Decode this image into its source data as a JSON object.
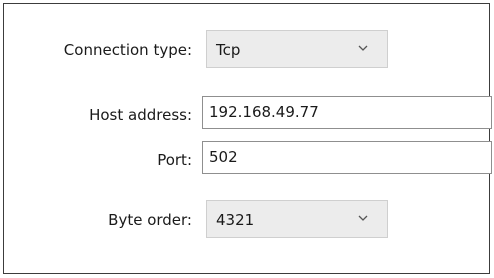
{
  "connection": {
    "type_label": "Connection type:",
    "type_value": "Tcp",
    "host_label": "Host address:",
    "host_value": "192.168.49.77",
    "port_label": "Port:",
    "port_value": "502",
    "byte_order_label": "Byte order:",
    "byte_order_value": "4321"
  },
  "icons": {
    "dropdown": "chevron-down-icon"
  },
  "colors": {
    "combo_background": "#ececec",
    "border": "#8f8f8f",
    "text": "#1a1a1a"
  }
}
